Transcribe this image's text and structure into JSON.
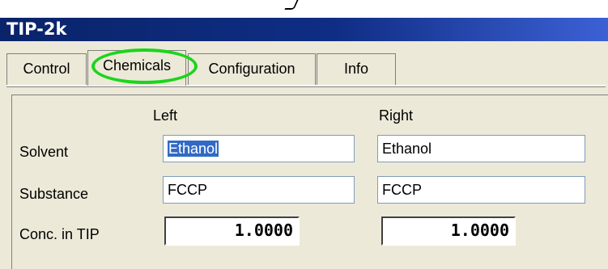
{
  "window": {
    "title": "TIP-2k"
  },
  "tabs": [
    {
      "label": "Control"
    },
    {
      "label": "Chemicals",
      "active": true
    },
    {
      "label": "Configuration"
    },
    {
      "label": "Info"
    }
  ],
  "columns": {
    "left": "Left",
    "right": "Right"
  },
  "rows": {
    "solvent": {
      "label": "Solvent",
      "left_value": "Ethanol",
      "right_value": "Ethanol"
    },
    "substance": {
      "label": "Substance",
      "left_value": "FCCP",
      "right_value": "FCCP"
    },
    "concentration": {
      "label": "Conc. in TIP",
      "left_value": "1.0000",
      "right_value": "1.0000"
    }
  },
  "colors": {
    "title_bar_start": "#0a246a",
    "title_bar_end": "#3c61d5",
    "window_bg": "#ece9d8",
    "selection": "#316ac5",
    "highlight_circle": "#1bd51b"
  }
}
